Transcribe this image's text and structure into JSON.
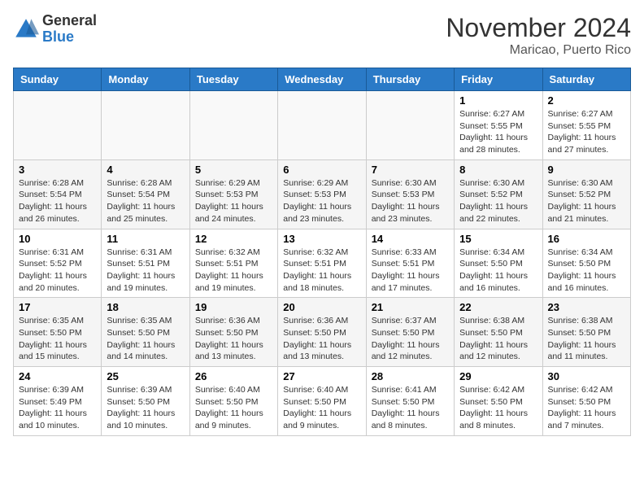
{
  "header": {
    "logo_general": "General",
    "logo_blue": "Blue",
    "month_year": "November 2024",
    "location": "Maricao, Puerto Rico"
  },
  "weekdays": [
    "Sunday",
    "Monday",
    "Tuesday",
    "Wednesday",
    "Thursday",
    "Friday",
    "Saturday"
  ],
  "weeks": [
    [
      {
        "day": "",
        "info": ""
      },
      {
        "day": "",
        "info": ""
      },
      {
        "day": "",
        "info": ""
      },
      {
        "day": "",
        "info": ""
      },
      {
        "day": "",
        "info": ""
      },
      {
        "day": "1",
        "info": "Sunrise: 6:27 AM\nSunset: 5:55 PM\nDaylight: 11 hours\nand 28 minutes."
      },
      {
        "day": "2",
        "info": "Sunrise: 6:27 AM\nSunset: 5:55 PM\nDaylight: 11 hours\nand 27 minutes."
      }
    ],
    [
      {
        "day": "3",
        "info": "Sunrise: 6:28 AM\nSunset: 5:54 PM\nDaylight: 11 hours\nand 26 minutes."
      },
      {
        "day": "4",
        "info": "Sunrise: 6:28 AM\nSunset: 5:54 PM\nDaylight: 11 hours\nand 25 minutes."
      },
      {
        "day": "5",
        "info": "Sunrise: 6:29 AM\nSunset: 5:53 PM\nDaylight: 11 hours\nand 24 minutes."
      },
      {
        "day": "6",
        "info": "Sunrise: 6:29 AM\nSunset: 5:53 PM\nDaylight: 11 hours\nand 23 minutes."
      },
      {
        "day": "7",
        "info": "Sunrise: 6:30 AM\nSunset: 5:53 PM\nDaylight: 11 hours\nand 23 minutes."
      },
      {
        "day": "8",
        "info": "Sunrise: 6:30 AM\nSunset: 5:52 PM\nDaylight: 11 hours\nand 22 minutes."
      },
      {
        "day": "9",
        "info": "Sunrise: 6:30 AM\nSunset: 5:52 PM\nDaylight: 11 hours\nand 21 minutes."
      }
    ],
    [
      {
        "day": "10",
        "info": "Sunrise: 6:31 AM\nSunset: 5:52 PM\nDaylight: 11 hours\nand 20 minutes."
      },
      {
        "day": "11",
        "info": "Sunrise: 6:31 AM\nSunset: 5:51 PM\nDaylight: 11 hours\nand 19 minutes."
      },
      {
        "day": "12",
        "info": "Sunrise: 6:32 AM\nSunset: 5:51 PM\nDaylight: 11 hours\nand 19 minutes."
      },
      {
        "day": "13",
        "info": "Sunrise: 6:32 AM\nSunset: 5:51 PM\nDaylight: 11 hours\nand 18 minutes."
      },
      {
        "day": "14",
        "info": "Sunrise: 6:33 AM\nSunset: 5:51 PM\nDaylight: 11 hours\nand 17 minutes."
      },
      {
        "day": "15",
        "info": "Sunrise: 6:34 AM\nSunset: 5:50 PM\nDaylight: 11 hours\nand 16 minutes."
      },
      {
        "day": "16",
        "info": "Sunrise: 6:34 AM\nSunset: 5:50 PM\nDaylight: 11 hours\nand 16 minutes."
      }
    ],
    [
      {
        "day": "17",
        "info": "Sunrise: 6:35 AM\nSunset: 5:50 PM\nDaylight: 11 hours\nand 15 minutes."
      },
      {
        "day": "18",
        "info": "Sunrise: 6:35 AM\nSunset: 5:50 PM\nDaylight: 11 hours\nand 14 minutes."
      },
      {
        "day": "19",
        "info": "Sunrise: 6:36 AM\nSunset: 5:50 PM\nDaylight: 11 hours\nand 13 minutes."
      },
      {
        "day": "20",
        "info": "Sunrise: 6:36 AM\nSunset: 5:50 PM\nDaylight: 11 hours\nand 13 minutes."
      },
      {
        "day": "21",
        "info": "Sunrise: 6:37 AM\nSunset: 5:50 PM\nDaylight: 11 hours\nand 12 minutes."
      },
      {
        "day": "22",
        "info": "Sunrise: 6:38 AM\nSunset: 5:50 PM\nDaylight: 11 hours\nand 12 minutes."
      },
      {
        "day": "23",
        "info": "Sunrise: 6:38 AM\nSunset: 5:50 PM\nDaylight: 11 hours\nand 11 minutes."
      }
    ],
    [
      {
        "day": "24",
        "info": "Sunrise: 6:39 AM\nSunset: 5:49 PM\nDaylight: 11 hours\nand 10 minutes."
      },
      {
        "day": "25",
        "info": "Sunrise: 6:39 AM\nSunset: 5:50 PM\nDaylight: 11 hours\nand 10 minutes."
      },
      {
        "day": "26",
        "info": "Sunrise: 6:40 AM\nSunset: 5:50 PM\nDaylight: 11 hours\nand 9 minutes."
      },
      {
        "day": "27",
        "info": "Sunrise: 6:40 AM\nSunset: 5:50 PM\nDaylight: 11 hours\nand 9 minutes."
      },
      {
        "day": "28",
        "info": "Sunrise: 6:41 AM\nSunset: 5:50 PM\nDaylight: 11 hours\nand 8 minutes."
      },
      {
        "day": "29",
        "info": "Sunrise: 6:42 AM\nSunset: 5:50 PM\nDaylight: 11 hours\nand 8 minutes."
      },
      {
        "day": "30",
        "info": "Sunrise: 6:42 AM\nSunset: 5:50 PM\nDaylight: 11 hours\nand 7 minutes."
      }
    ]
  ]
}
